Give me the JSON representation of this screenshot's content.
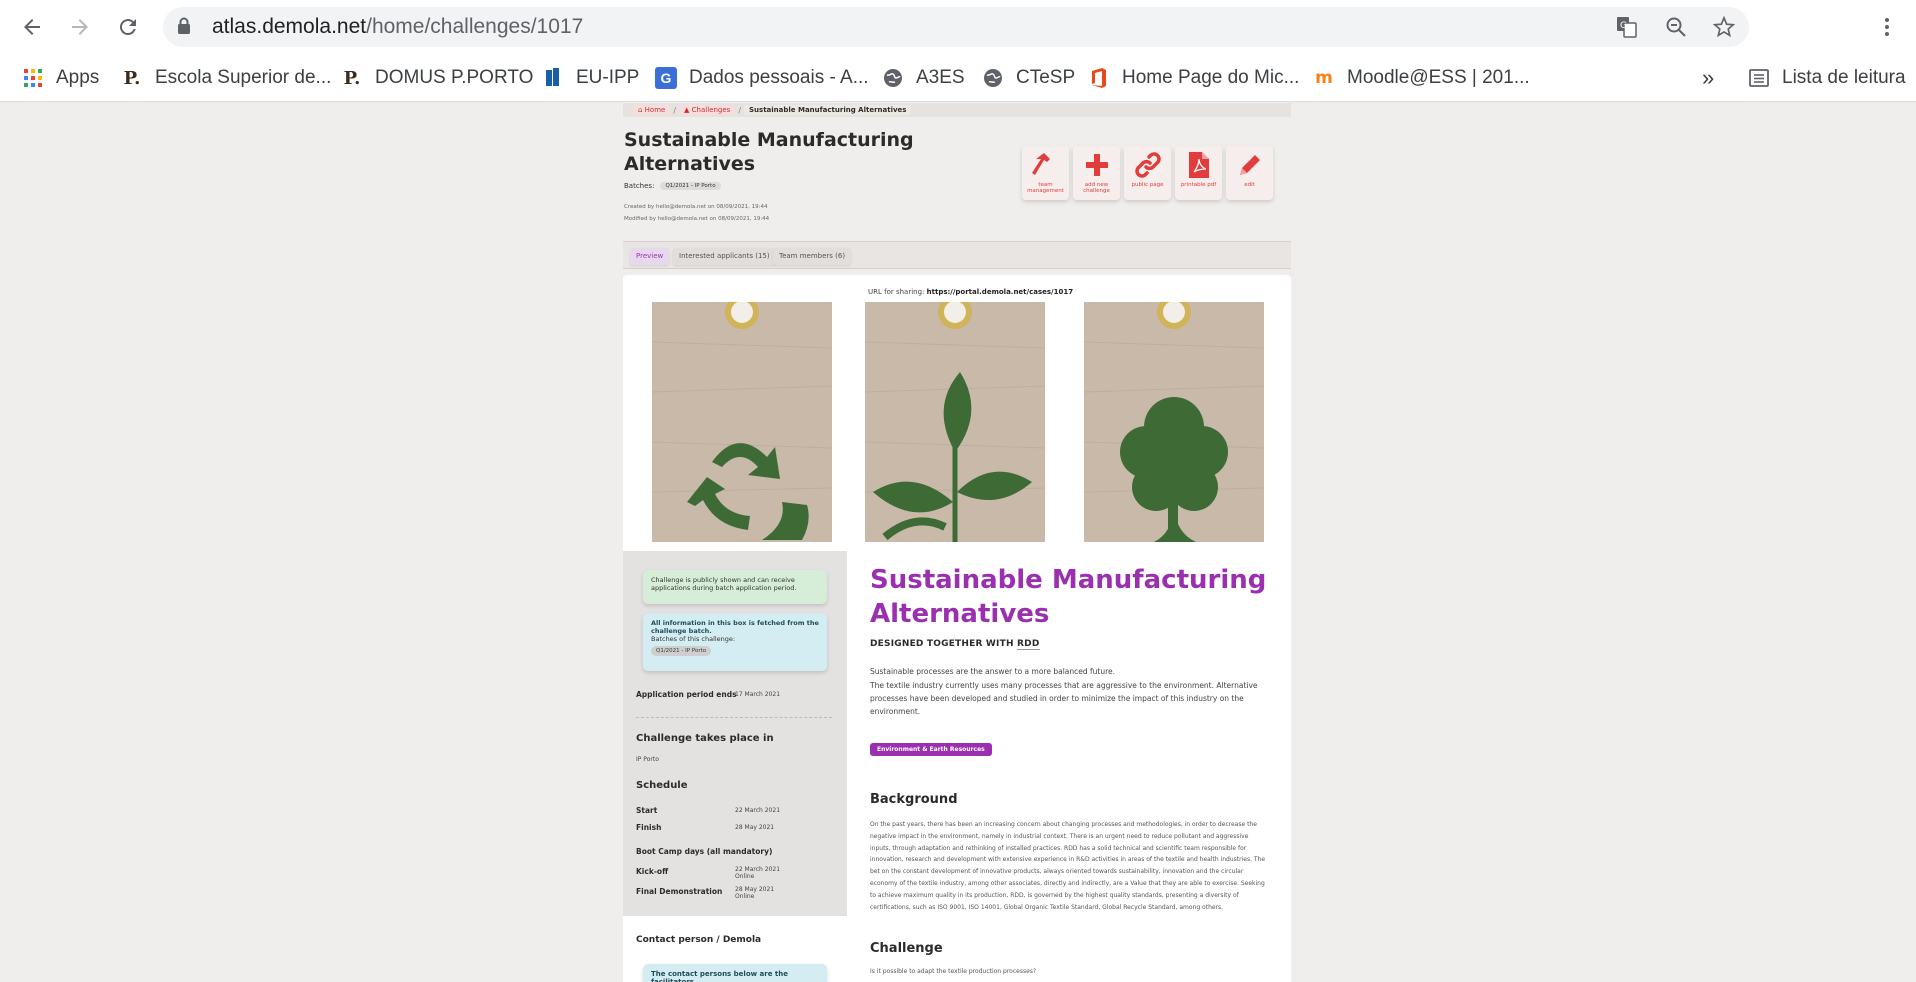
{
  "browser": {
    "url_host": "atlas.demola.net",
    "url_path": "/home/challenges/1017",
    "bookmarks": [
      {
        "label": "Apps",
        "icon": "apps-grid-icon"
      },
      {
        "label": "Escola Superior de...",
        "icon": "p-logo-icon"
      },
      {
        "label": "DOMUS P.PORTO",
        "icon": "p-logo-icon"
      },
      {
        "label": "EU-IPP",
        "icon": "book-icon"
      },
      {
        "label": "Dados pessoais - A...",
        "icon": "g-logo-icon"
      },
      {
        "label": "A3ES",
        "icon": "globe-icon"
      },
      {
        "label": "CTeSP",
        "icon": "globe-icon"
      },
      {
        "label": "Home Page do Mic...",
        "icon": "office-icon"
      },
      {
        "label": "Moodle@ESS | 201...",
        "icon": "moodle-icon"
      }
    ],
    "overflow": "»",
    "reading_list": "Lista de leitura"
  },
  "breadcrumb": [
    "Home",
    "Challenges",
    "Sustainable Manufacturing Alternatives"
  ],
  "header": {
    "title": "Sustainable Manufacturing Alternatives",
    "batches_label": "Batches:",
    "batch_chip": "Q1/2021 - IP Porto",
    "created": "Created by hello@demola.net on 08/09/2021, 19:44",
    "modified": "Modified by hello@demola.net on 08/09/2021, 19:44"
  },
  "actions": [
    {
      "label": "team management",
      "icon": "hammer-icon"
    },
    {
      "label": "add new challenge",
      "icon": "plus-icon"
    },
    {
      "label": "public page",
      "icon": "link-icon"
    },
    {
      "label": "printable pdf",
      "icon": "pdf-icon"
    },
    {
      "label": "edit",
      "icon": "pencil-icon"
    }
  ],
  "tabs": [
    "Preview",
    "Interested applicants (15)",
    "Team members (6)"
  ],
  "share": {
    "label": "URL for sharing:",
    "url": "https://portal.demola.net/cases/1017"
  },
  "sidebar": {
    "public_note": "Challenge is publicly shown and can receive applications during batch application period.",
    "info_note_title": "All information in this box is fetched from the challenge batch.",
    "info_note_batches": "Batches of this challenge:",
    "info_note_chip": "Q1/2021 - IP Porto",
    "app_ends_label": "Application period ends",
    "app_ends_value": "17 March 2021",
    "location_title": "Challenge takes place in",
    "location_value": "IP Porto",
    "schedule_title": "Schedule",
    "start_label": "Start",
    "start_value": "22 March 2021",
    "finish_label": "Finish",
    "finish_value": "28 May 2021",
    "bootcamp_title": "Boot Camp days (all mandatory)",
    "kickoff_label": "Kick-off",
    "kickoff_value": "22 March 2021",
    "kickoff_mode": "Online",
    "final_label": "Final Demonstration",
    "final_value": "28 May 2021",
    "final_mode": "Online",
    "contact_title": "Contact person / Demola",
    "contact_note": "The contact persons below are the facilitators"
  },
  "main": {
    "title": "Sustainable Manufacturing Alternatives",
    "designed_prefix": "DESIGNED TOGETHER WITH",
    "designed_partner": "RDD",
    "intro_1": "Sustainable processes are the answer to a more balanced future.",
    "intro_2": "The textile industry currently uses many processes that are aggressive to the environment. Alternative processes have been developed and studied in order to minimize the impact of this industry on the environment.",
    "badge": "Environment & Earth Resources",
    "background_title": "Background",
    "background_text": "On the past years, there has been an increasing concern about changing processes and methodologies, in order to decrease the negative impact in the environment, namely in industrial context. There is an urgent need to reduce pollutant and aggressive inputs, through adaptation and rethinking of installed practices. RDD has a solid technical and scientific team responsible for innovation, research and development with extensive experience in R&D activities in areas of the textile and health industries. The bet on the constant development of innovative products, always oriented towards sustainability, innovation and the circular economy of the textile industry, among other associates, directly and indirectly, are a Value that they are able to exercise. Seeking to achieve maximum quality in its production, RDD, is governed by the highest quality standards, presenting a diversity of certifications, such as ISO 9001, ISO 14001, Global Organic Textile Standard, Global Recycle Standard, among others.",
    "challenge_title": "Challenge",
    "challenge_text": "Is it possible to adapt the textile production processes?"
  },
  "colors": {
    "accent": "#9a2fb0",
    "action_red": "#e23c3c",
    "tag_kraft": "#c8b9a8",
    "leaf_green": "#3e6b35"
  }
}
